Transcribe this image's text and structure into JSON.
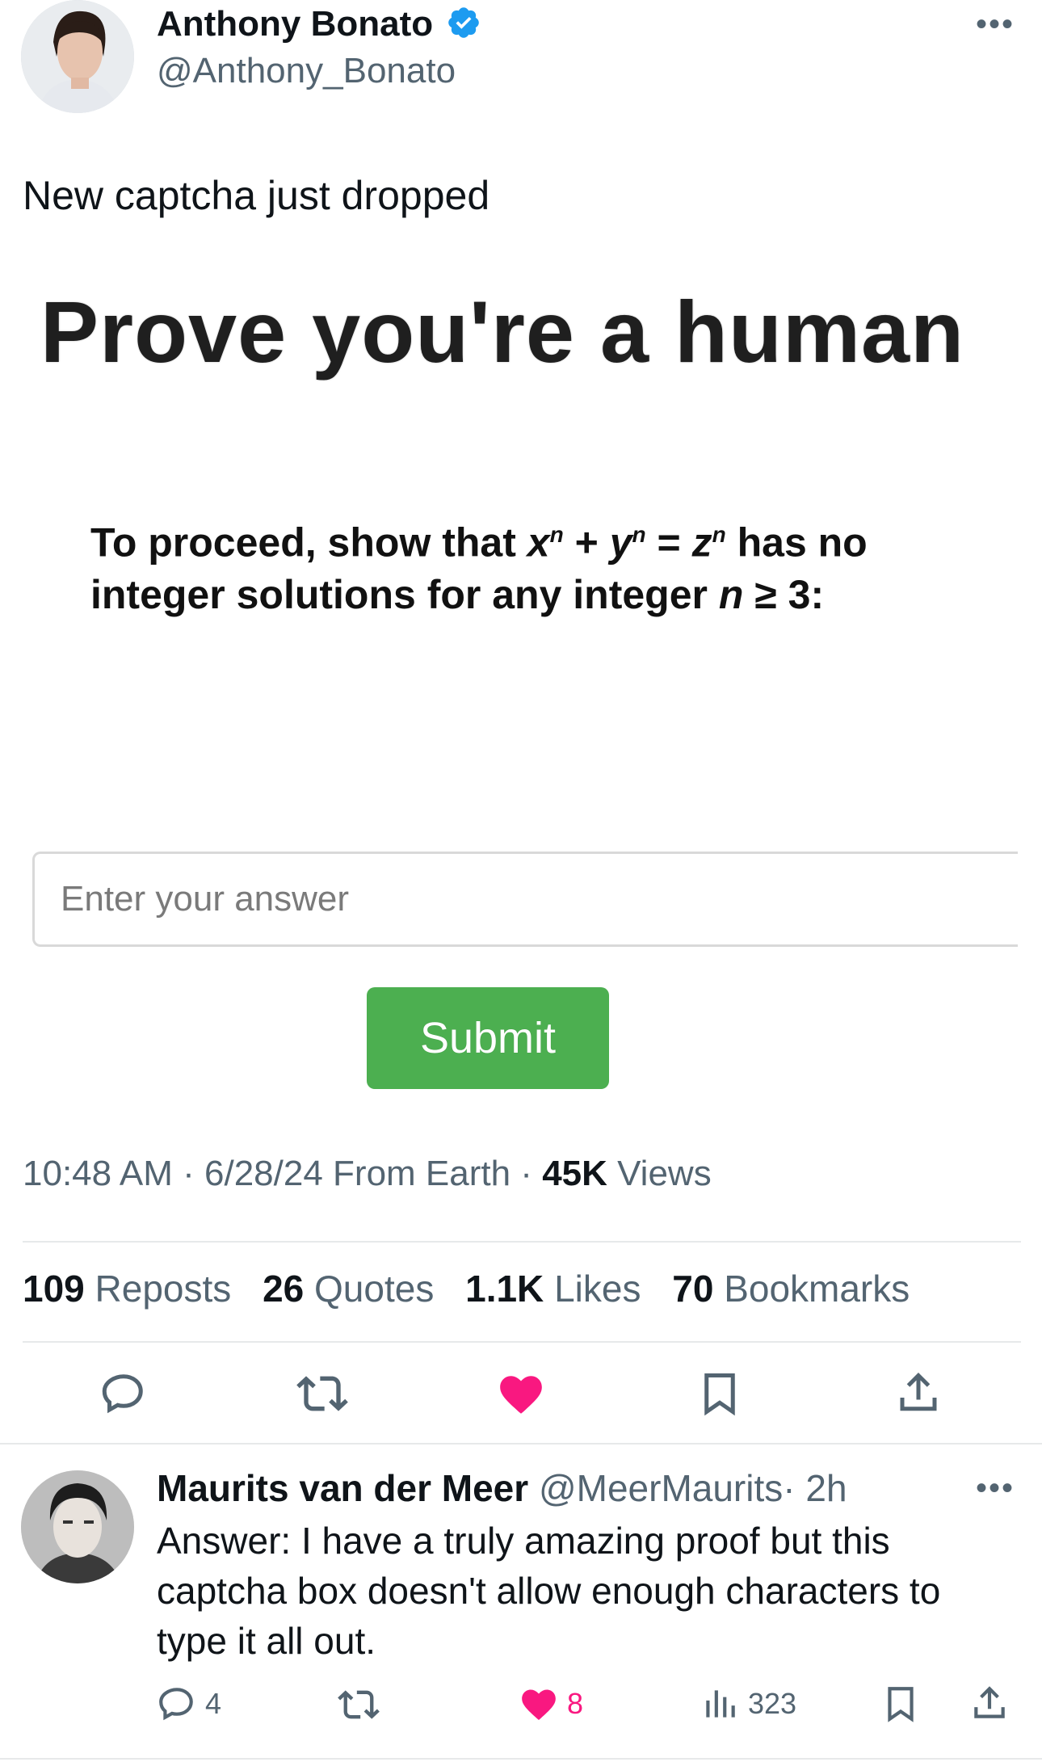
{
  "post": {
    "author_name": "Anthony Bonato",
    "author_handle": "@Anthony_Bonato",
    "more_label": "•••",
    "text": "New captcha just dropped",
    "timestamp": "10:48 AM · 6/28/24 From Earth · ",
    "views_count": "45K",
    "views_label": " Views",
    "stats": {
      "reposts_count": "109",
      "reposts_label": "Reposts",
      "quotes_count": "26",
      "quotes_label": "Quotes",
      "likes_count": "1.1K",
      "likes_label": "Likes",
      "bookmarks_count": "70",
      "bookmarks_label": "Bookmarks"
    }
  },
  "captcha": {
    "title": "Prove you're a human",
    "instruction_part1": "To proceed, show that ",
    "instruction_part2": " has no",
    "instruction_line2a": "integer solutions for any integer ",
    "instruction_line2b": " ≥ 3:",
    "placeholder": "Enter your answer",
    "submit_label": "Submit"
  },
  "reply": {
    "author_name": "Maurits van der Meer",
    "author_handle": "@MeerMaurits",
    "time": "· 2h",
    "more_label": "•••",
    "text": "Answer: I have a truly amazing proof but this captcha box doesn't allow enough characters to type it all out.",
    "replies": "4",
    "likes": "8",
    "views": "323"
  },
  "icons": {
    "verified": "verified-badge-icon",
    "reply": "speech-bubble-icon",
    "repost": "repost-arrows-icon",
    "like": "heart-icon",
    "bookmark": "bookmark-icon",
    "share": "share-upload-icon",
    "views": "bar-chart-icon"
  },
  "colors": {
    "accent_blue": "#1d9bf0",
    "like_pink": "#f91880",
    "submit_green": "#4caf50",
    "muted": "#536471"
  }
}
